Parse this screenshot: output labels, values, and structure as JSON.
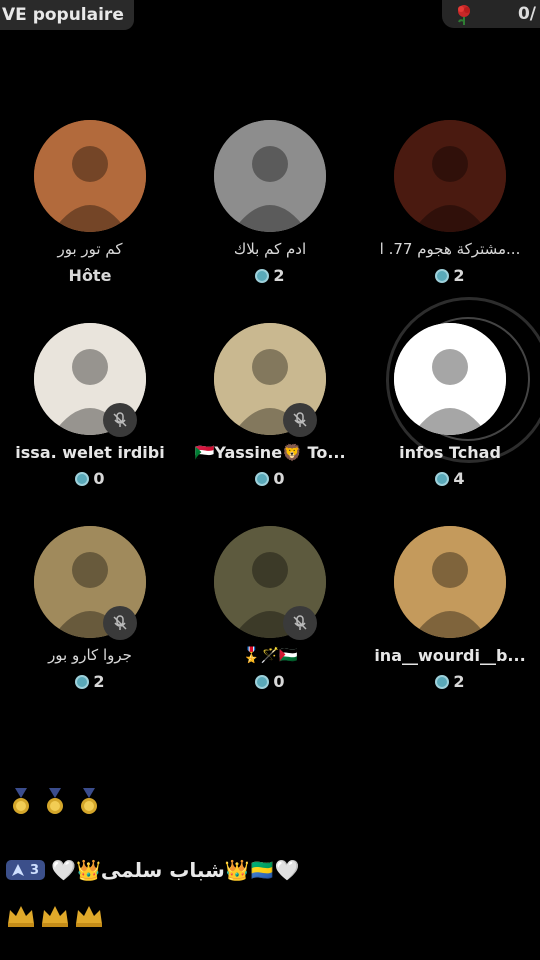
{
  "header": {
    "left_label": "VE populaire",
    "right_count": "0/",
    "right_icon": "rose-icon"
  },
  "seats": [
    {
      "name": "كم تور بور",
      "sub_label": "Hôte",
      "score": null,
      "muted": false,
      "avatar_color": "#b26a3c"
    },
    {
      "name": "ادم كم بلاك",
      "sub_label": null,
      "score": "2",
      "muted": false,
      "avatar_color": "#8d8d8d"
    },
    {
      "name": "مشتركة هجوم 77. ا...",
      "sub_label": null,
      "score": "2",
      "muted": false,
      "avatar_color": "#4a1a10"
    },
    {
      "name": "issa. welet irdibi",
      "sub_label": null,
      "score": "0",
      "muted": true,
      "avatar_color": "#e9e4dc"
    },
    {
      "name": "Yassine🦁 To...",
      "flag_prefix": "🇸🇩",
      "sub_label": null,
      "score": "0",
      "muted": true,
      "avatar_color": "#c9b890"
    },
    {
      "name": "infos Tchad",
      "sub_label": null,
      "score": "4",
      "muted": false,
      "avatar_color": "#ffffff"
    },
    {
      "name": "جروا كارو بور",
      "sub_label": null,
      "score": "2",
      "muted": true,
      "avatar_color": "#a08a5c"
    },
    {
      "name": "🎖️🪄🇵🇸",
      "sub_label": null,
      "score": "0",
      "muted": true,
      "avatar_color": "#5d5a3e"
    },
    {
      "name": "ina__wourdi__b...",
      "sub_label": null,
      "score": "2",
      "muted": false,
      "avatar_color": "#c49a5c"
    }
  ],
  "chat": {
    "medals": [
      "medal-icon",
      "medal-icon",
      "medal-icon"
    ],
    "level": "3",
    "message": "🤍👑شباب سلمى👑🇬🇦🤍",
    "crowns": [
      "crown-icon",
      "crown-icon",
      "crown-icon"
    ]
  }
}
